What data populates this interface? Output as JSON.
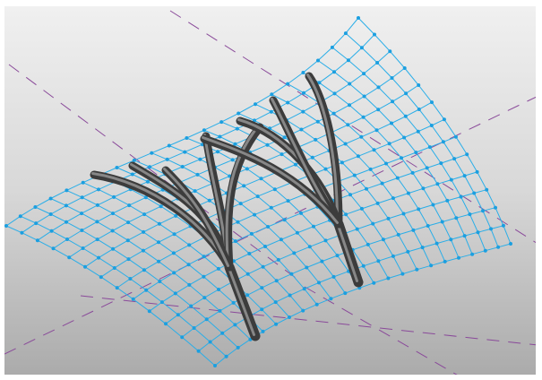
{
  "viewport": {
    "background_top": "#f0f0f0",
    "background_bottom": "#ababab"
  },
  "colors": {
    "mesh_line": "#2aaee8",
    "mesh_node": "#1b9fe0",
    "reference_plane": "#8a4a9a",
    "column_dark": "#3c3c3c",
    "column_light": "#9a9a9a"
  },
  "mesh": {
    "rows": 13,
    "cols": 22
  },
  "icons": [
    "surface-mesh",
    "tree-column",
    "reference-plane"
  ]
}
